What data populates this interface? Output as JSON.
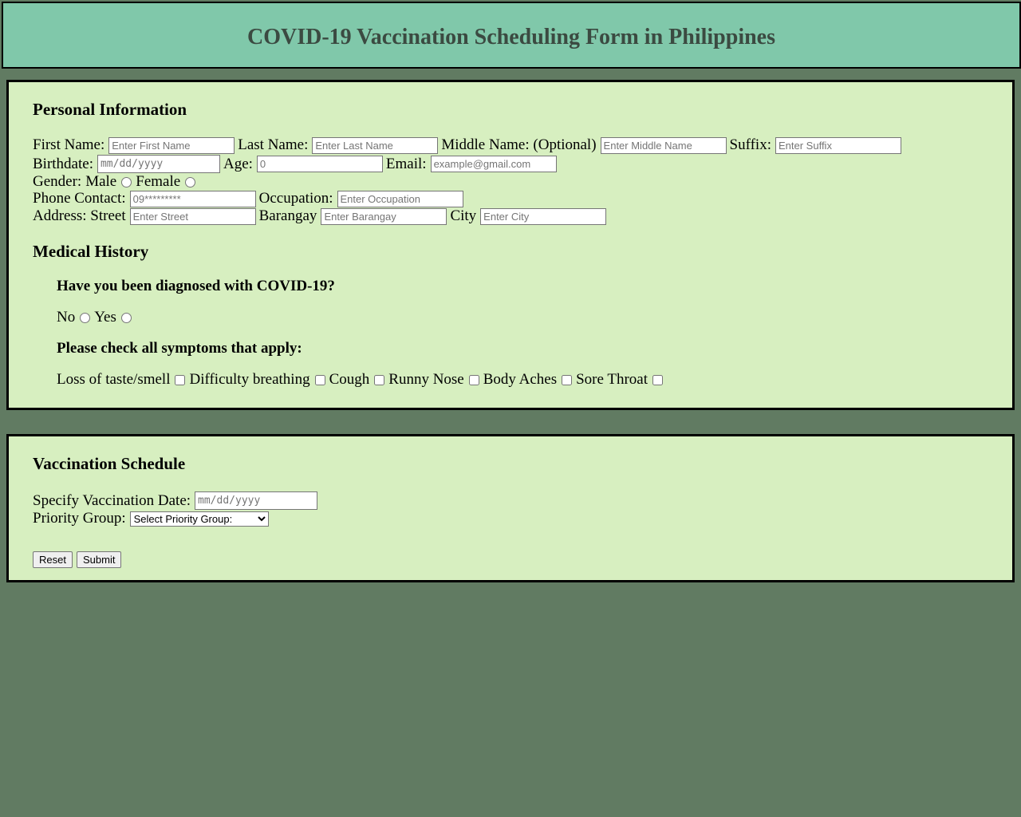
{
  "header": {
    "title": "COVID-19 Vaccination Scheduling Form in Philippines"
  },
  "personal": {
    "title": "Personal Information",
    "first_name": {
      "label": "First Name:",
      "placeholder": "Enter First Name"
    },
    "last_name": {
      "label": "Last Name:",
      "placeholder": "Enter Last Name"
    },
    "middle_name": {
      "label": "Middle Name: (Optional)",
      "placeholder": "Enter Middle Name"
    },
    "suffix": {
      "label": "Suffix:",
      "placeholder": "Enter Suffix"
    },
    "birthdate": {
      "label": "Birthdate:",
      "placeholder": "mm/dd/yyyy"
    },
    "age": {
      "label": "Age:",
      "placeholder": "0"
    },
    "email": {
      "label": "Email:",
      "placeholder": "example@gmail.com"
    },
    "gender": {
      "label": "Gender:",
      "male": "Male",
      "female": "Female"
    },
    "phone": {
      "label": "Phone Contact:",
      "placeholder": "09*********"
    },
    "occupation": {
      "label": "Occupation:",
      "placeholder": "Enter Occupation"
    },
    "address": {
      "label": "Address: Street",
      "street_placeholder": "Enter Street",
      "barangay_label": "Barangay",
      "barangay_placeholder": "Enter Barangay",
      "city_label": "City",
      "city_placeholder": "Enter City"
    }
  },
  "medical": {
    "title": "Medical History",
    "diagnosed_question": "Have you been diagnosed with COVID-19?",
    "no": "No",
    "yes": "Yes",
    "symptoms_question": "Please check all symptoms that apply:",
    "symptoms": [
      "Loss of taste/smell",
      "Difficulty breathing",
      "Cough",
      "Runny Nose",
      "Body Aches",
      "Sore Throat"
    ]
  },
  "schedule": {
    "title": "Vaccination Schedule",
    "date_label": "Specify Vaccination Date:",
    "date_placeholder": "mm/dd/yyyy",
    "priority_label": "Priority Group:",
    "priority_selected": "Select Priority Group:",
    "reset": "Reset",
    "submit": "Submit"
  }
}
